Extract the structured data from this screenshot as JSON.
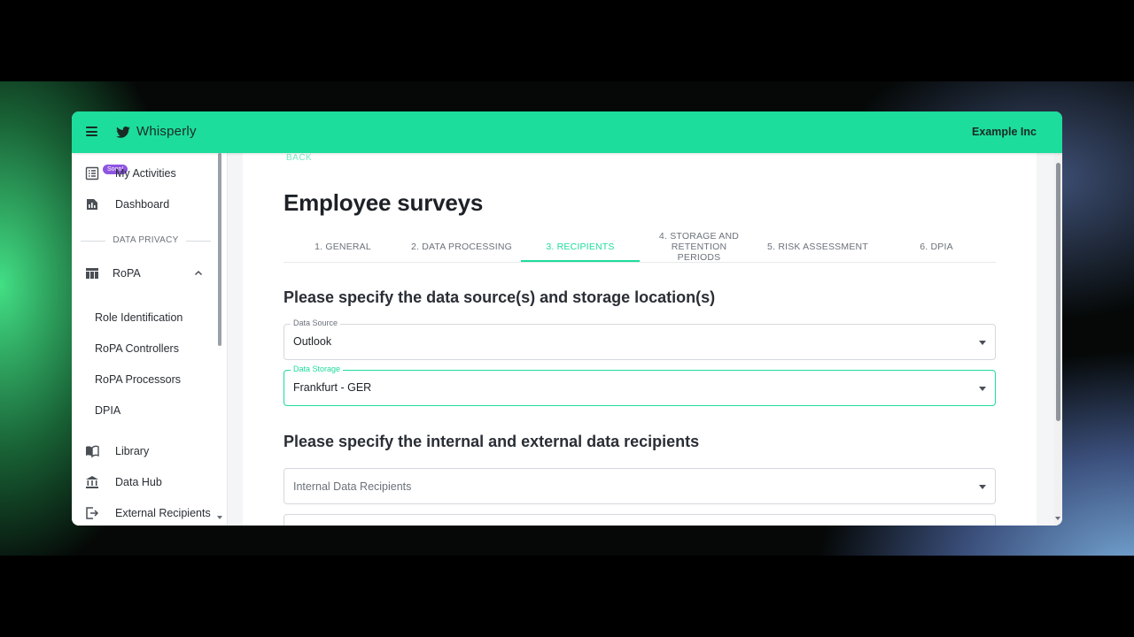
{
  "app": {
    "brand": "Whisperly",
    "organization": "Example Inc"
  },
  "sidebar": {
    "items": [
      {
        "label": "My Activities",
        "icon": "list-icon",
        "badge": "Soon!"
      },
      {
        "label": "Dashboard",
        "icon": "dashboard-icon"
      }
    ],
    "section_label": "DATA PRIVACY",
    "ropa": {
      "label": "RoPA",
      "icon": "table-icon",
      "expanded": true,
      "children": [
        "Role Identification",
        "RoPA Controllers",
        "RoPA Processors",
        "DPIA"
      ]
    },
    "bottom_items": [
      {
        "label": "Library",
        "icon": "book-icon"
      },
      {
        "label": "Data Hub",
        "icon": "bank-icon"
      },
      {
        "label": "External Recipients",
        "icon": "exit-icon"
      }
    ]
  },
  "main": {
    "back_label": "BACK",
    "title": "Employee surveys",
    "tabs": [
      {
        "label": "1. GENERAL"
      },
      {
        "label": "2. DATA PROCESSING"
      },
      {
        "label": "3. RECIPIENTS",
        "active": true
      },
      {
        "label": "4. STORAGE AND RETENTION PERIODS"
      },
      {
        "label": "5. RISK ASSESSMENT"
      },
      {
        "label": "6. DPIA"
      }
    ],
    "section1_heading": "Please specify the data source(s) and storage location(s)",
    "data_source": {
      "label": "Data Source",
      "value": "Outlook"
    },
    "data_storage": {
      "label": "Data Storage",
      "value": "Frankfurt - GER"
    },
    "section2_heading": "Please specify the internal and external data recipients",
    "internal_recipients": {
      "placeholder": "Internal Data Recipients"
    }
  },
  "colors": {
    "accent": "#1ddd9c",
    "badge": "#8e55e0"
  }
}
